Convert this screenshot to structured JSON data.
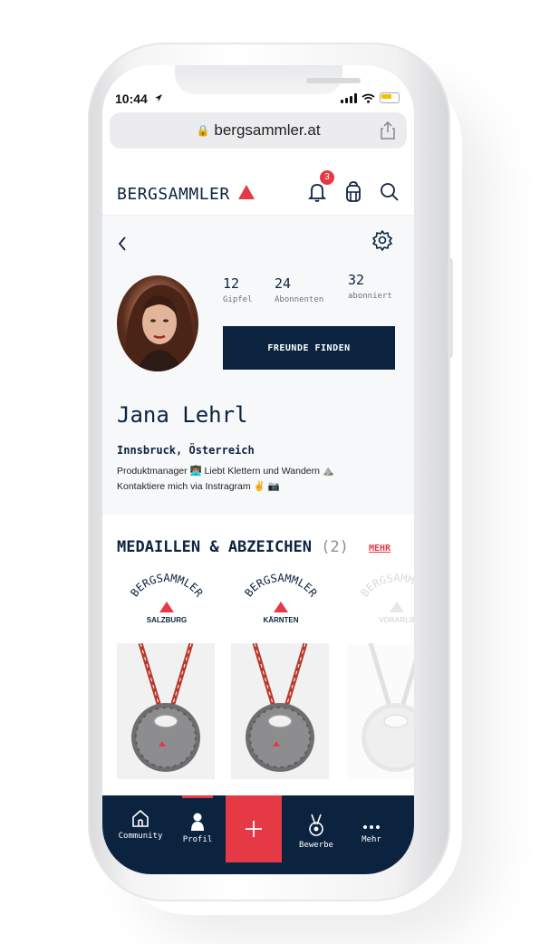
{
  "status_bar": {
    "time": "10:44"
  },
  "browser": {
    "url": "bergsammler.at"
  },
  "header": {
    "logo_text": "BERGSAMMLER",
    "notification_count": "3"
  },
  "profile": {
    "stats": [
      {
        "value": "12",
        "label": "Gipfel"
      },
      {
        "value": "24",
        "label": "Abonnenten"
      },
      {
        "value": "32",
        "label": "abonniert"
      }
    ],
    "find_friends_label": "FREUNDE FINDEN",
    "name": "Jana Lehrl",
    "location": "Innsbruck, Österreich",
    "bio_line1": "Produktmanager 👨🏽‍💻 Liebt Klettern und Wandern ⛰️",
    "bio_line2": "Kontaktiere mich via Instragram ✌️ 📷"
  },
  "medals": {
    "title": "MEDAILLEN & ABZEICHEN",
    "count": "(2)",
    "more_label": "MEHR",
    "badge_brand": "BERGSAMMLER",
    "items": [
      {
        "region": "SALZBURG"
      },
      {
        "region": "KÄRNTEN"
      },
      {
        "region": "VORARLB"
      }
    ]
  },
  "tabbar": {
    "community": "Community",
    "profil": "Profil",
    "bewerbe": "Bewerbe",
    "mehr": "Mehr"
  },
  "colors": {
    "navy": "#0c2340",
    "accent_red": "#e63946"
  }
}
